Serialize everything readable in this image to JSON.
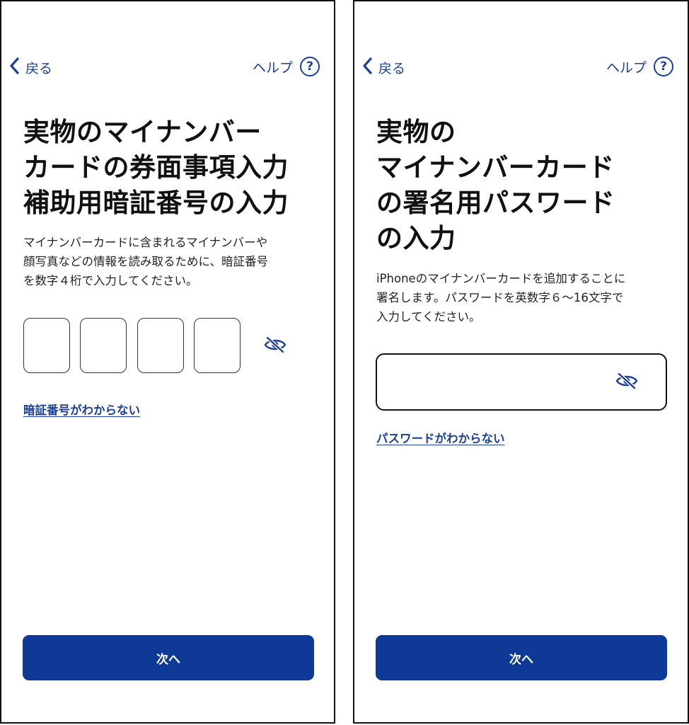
{
  "left_screen": {
    "back_label": "戻る",
    "help_label": "ヘルプ",
    "help_symbol": "?",
    "title_lines": [
      "実物のマイナンバー",
      "カードの券面事項入力",
      "補助用暗証番号の入力"
    ],
    "description_lines": [
      "マイナンバーカードに含まれるマイナンバーや",
      "顔写真などの情報を読み取るために、暗証番号",
      "を数字４桁で入力してください。"
    ],
    "pin_digits": [
      "",
      "",
      "",
      ""
    ],
    "forgot_link": "暗証番号がわからない",
    "next_label": "次へ"
  },
  "right_screen": {
    "back_label": "戻る",
    "help_label": "ヘルプ",
    "help_symbol": "?",
    "title_lines": [
      "実物の",
      "マイナンバーカード",
      "の署名用パスワード",
      "の入力"
    ],
    "description_lines": [
      "iPhoneのマイナンバーカードを追加することに",
      "署名します。パスワードを英数字６〜16文字で",
      "入力してください。"
    ],
    "password_value": "",
    "forgot_link": "パスワードがわからない",
    "next_label": "次へ"
  },
  "icons": {
    "back": "chevron-left-icon",
    "help": "question-circle-icon",
    "visibility": "eye-slash-icon"
  },
  "colors": {
    "accent": "#1c3f9c",
    "button": "#0f3996",
    "button_text": "#ffffff",
    "text": "#111111"
  }
}
